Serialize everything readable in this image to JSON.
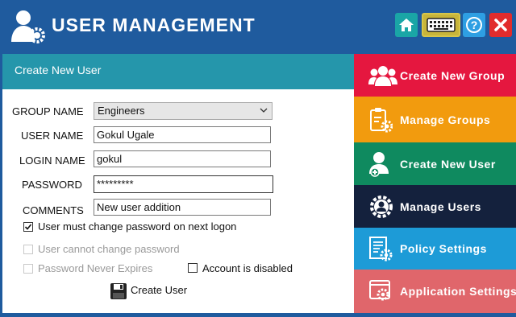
{
  "window": {
    "title": "USER MANAGEMENT"
  },
  "title_buttons": [
    {
      "icon": "home-icon",
      "color": "#1aa6a6"
    },
    {
      "icon": "keyboard-icon",
      "color": "#c8b53a"
    },
    {
      "icon": "help-icon",
      "color": "#2e9fe3"
    },
    {
      "icon": "close-icon",
      "color": "#e22c2c"
    }
  ],
  "form": {
    "header": "Create New User",
    "group_label": "GROUP NAME",
    "group_value": "Engineers",
    "username_label": "USER NAME",
    "username_value": "Gokul Ugale",
    "login_label": "LOGIN NAME",
    "login_value": "gokul",
    "password_label": "PASSWORD",
    "password_value": "*********",
    "comments_label": "COMMENTS",
    "comments_value": "New user addition",
    "options": {
      "must_change": {
        "label": "User must change password on next logon",
        "checked": true,
        "enabled": true
      },
      "cannot_change": {
        "label": "User cannot change password",
        "checked": false,
        "enabled": false
      },
      "never_expires": {
        "label": "Password Never Expires",
        "checked": false,
        "enabled": false
      },
      "disabled": {
        "label": "Account is disabled",
        "checked": false,
        "enabled": true
      }
    },
    "create_button": "Create User"
  },
  "sidebar": {
    "items": [
      {
        "label": "Create New Group",
        "color": "#e5173f",
        "icon": "users-icon"
      },
      {
        "label": "Manage Groups",
        "color": "#f29b0e",
        "icon": "clipboard-gear-icon"
      },
      {
        "label": "Create New User",
        "color": "#0f8a5f",
        "icon": "add-user-icon"
      },
      {
        "label": "Manage Users",
        "color": "#14213d",
        "icon": "user-gear-icon"
      },
      {
        "label": "Policy Settings",
        "color": "#1d9bd7",
        "icon": "policy-icon"
      },
      {
        "label": "Application Settings",
        "color": "#e0666b",
        "icon": "app-settings-icon"
      }
    ]
  }
}
